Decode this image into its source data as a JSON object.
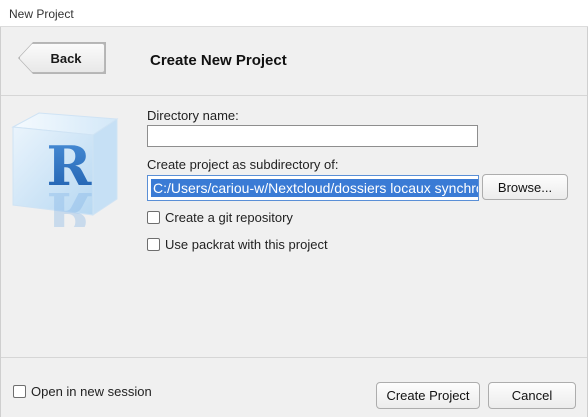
{
  "window": {
    "title": "New Project"
  },
  "header": {
    "back_label": "Back",
    "title": "Create New Project"
  },
  "form": {
    "directory_name_label": "Directory name:",
    "directory_name_value": "",
    "subdirectory_label": "Create project as subdirectory of:",
    "subdirectory_value": "C:/Users/cariou-w/Nextcloud/dossiers locaux synchronisés",
    "browse_label": "Browse...",
    "git_label": "Create a git repository",
    "git_checked": false,
    "packrat_label": "Use packrat with this project",
    "packrat_checked": false
  },
  "footer": {
    "new_session_label": "Open in new session",
    "new_session_checked": false,
    "create_label": "Create Project",
    "cancel_label": "Cancel"
  },
  "icons": {
    "logo": "r-logo-icon"
  },
  "colors": {
    "selection": "#3a7bd5",
    "logo_blue": "#2a6fc0"
  }
}
